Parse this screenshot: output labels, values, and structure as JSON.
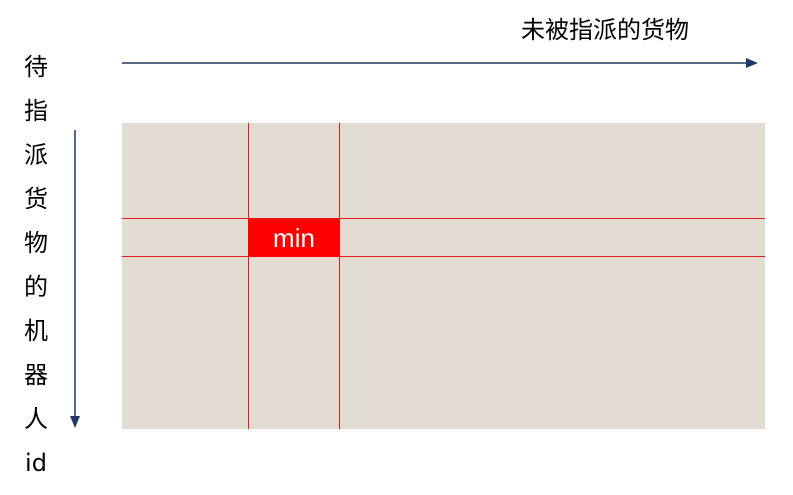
{
  "top_axis_label": "未被指派的货物",
  "left_axis_label_chars": [
    "待",
    "指",
    "派",
    "货",
    "物",
    "的",
    "机",
    "器",
    "人",
    "id"
  ],
  "min_cell_label": "min",
  "colors": {
    "matrix_fill": "#e2dcd2",
    "grid_line": "#e8191c",
    "min_fill": "#ff0000",
    "arrow": "#1f3864"
  }
}
